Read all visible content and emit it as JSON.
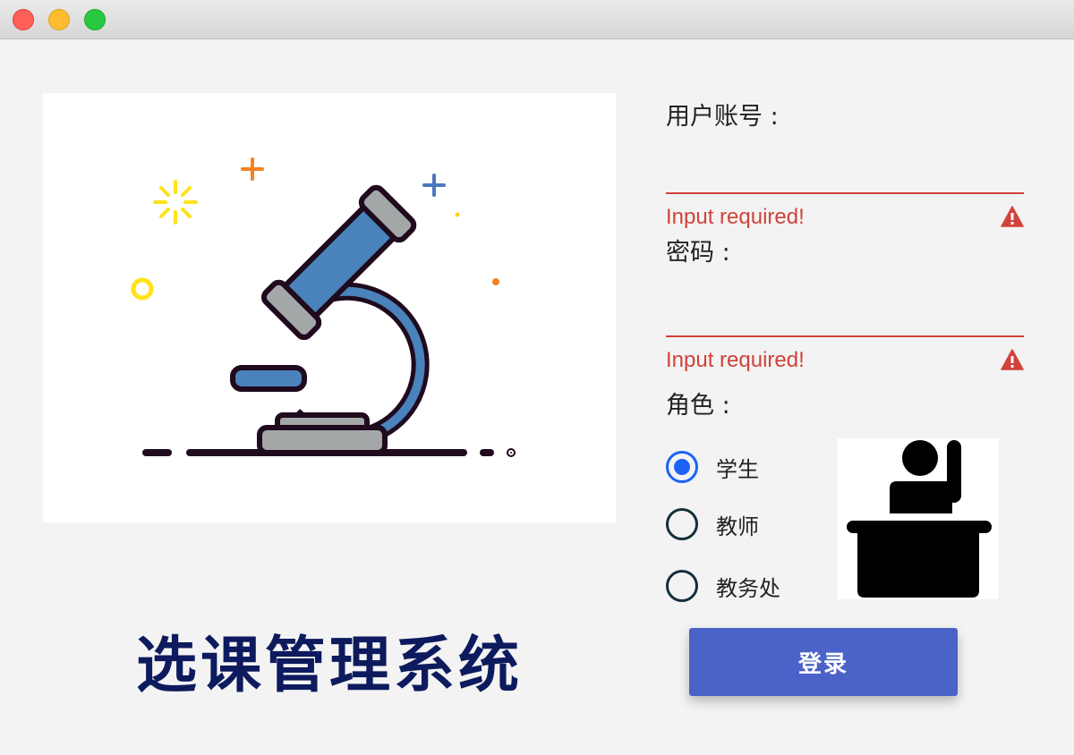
{
  "window": {
    "controls": [
      "close",
      "minimize",
      "zoom"
    ],
    "colors": {
      "close": "#fe5f57",
      "minimize": "#febc2e",
      "zoom": "#28c840"
    }
  },
  "hero": {
    "icon": "microscope-illustration"
  },
  "app": {
    "title": "选课管理系统",
    "title_color": "#0d1b5e"
  },
  "form": {
    "username": {
      "label": "用户账号 :",
      "value": "",
      "error": "Input required!"
    },
    "password": {
      "label": "密码 :",
      "value": "",
      "error": "Input required!"
    },
    "role": {
      "label": "角色 :",
      "options": [
        {
          "label": "学生",
          "checked": true
        },
        {
          "label": "教师",
          "checked": false
        },
        {
          "label": "教务处",
          "checked": false
        }
      ],
      "image_icon": "teacher-at-desk-icon"
    },
    "error_color": "#d0423a"
  },
  "actions": {
    "login_label": "登录",
    "login_color": "#4b62c8"
  }
}
